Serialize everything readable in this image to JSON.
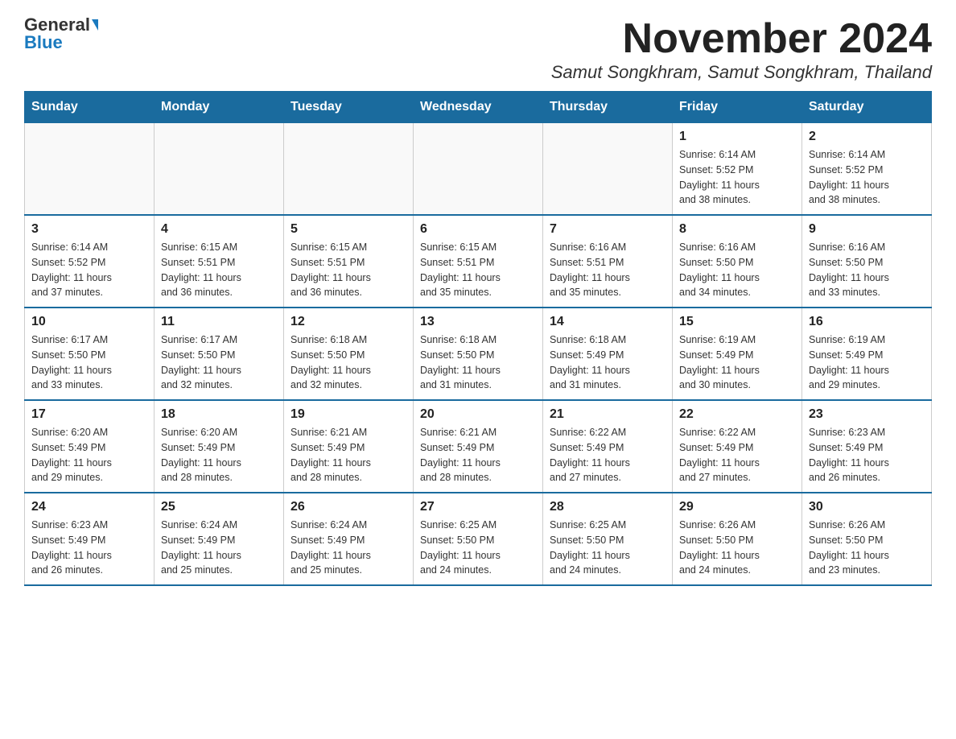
{
  "logo": {
    "general": "General",
    "blue": "Blue"
  },
  "header": {
    "month": "November 2024",
    "location": "Samut Songkhram, Samut Songkhram, Thailand"
  },
  "weekdays": [
    "Sunday",
    "Monday",
    "Tuesday",
    "Wednesday",
    "Thursday",
    "Friday",
    "Saturday"
  ],
  "weeks": [
    [
      {
        "day": "",
        "info": ""
      },
      {
        "day": "",
        "info": ""
      },
      {
        "day": "",
        "info": ""
      },
      {
        "day": "",
        "info": ""
      },
      {
        "day": "",
        "info": ""
      },
      {
        "day": "1",
        "info": "Sunrise: 6:14 AM\nSunset: 5:52 PM\nDaylight: 11 hours\nand 38 minutes."
      },
      {
        "day": "2",
        "info": "Sunrise: 6:14 AM\nSunset: 5:52 PM\nDaylight: 11 hours\nand 38 minutes."
      }
    ],
    [
      {
        "day": "3",
        "info": "Sunrise: 6:14 AM\nSunset: 5:52 PM\nDaylight: 11 hours\nand 37 minutes."
      },
      {
        "day": "4",
        "info": "Sunrise: 6:15 AM\nSunset: 5:51 PM\nDaylight: 11 hours\nand 36 minutes."
      },
      {
        "day": "5",
        "info": "Sunrise: 6:15 AM\nSunset: 5:51 PM\nDaylight: 11 hours\nand 36 minutes."
      },
      {
        "day": "6",
        "info": "Sunrise: 6:15 AM\nSunset: 5:51 PM\nDaylight: 11 hours\nand 35 minutes."
      },
      {
        "day": "7",
        "info": "Sunrise: 6:16 AM\nSunset: 5:51 PM\nDaylight: 11 hours\nand 35 minutes."
      },
      {
        "day": "8",
        "info": "Sunrise: 6:16 AM\nSunset: 5:50 PM\nDaylight: 11 hours\nand 34 minutes."
      },
      {
        "day": "9",
        "info": "Sunrise: 6:16 AM\nSunset: 5:50 PM\nDaylight: 11 hours\nand 33 minutes."
      }
    ],
    [
      {
        "day": "10",
        "info": "Sunrise: 6:17 AM\nSunset: 5:50 PM\nDaylight: 11 hours\nand 33 minutes."
      },
      {
        "day": "11",
        "info": "Sunrise: 6:17 AM\nSunset: 5:50 PM\nDaylight: 11 hours\nand 32 minutes."
      },
      {
        "day": "12",
        "info": "Sunrise: 6:18 AM\nSunset: 5:50 PM\nDaylight: 11 hours\nand 32 minutes."
      },
      {
        "day": "13",
        "info": "Sunrise: 6:18 AM\nSunset: 5:50 PM\nDaylight: 11 hours\nand 31 minutes."
      },
      {
        "day": "14",
        "info": "Sunrise: 6:18 AM\nSunset: 5:49 PM\nDaylight: 11 hours\nand 31 minutes."
      },
      {
        "day": "15",
        "info": "Sunrise: 6:19 AM\nSunset: 5:49 PM\nDaylight: 11 hours\nand 30 minutes."
      },
      {
        "day": "16",
        "info": "Sunrise: 6:19 AM\nSunset: 5:49 PM\nDaylight: 11 hours\nand 29 minutes."
      }
    ],
    [
      {
        "day": "17",
        "info": "Sunrise: 6:20 AM\nSunset: 5:49 PM\nDaylight: 11 hours\nand 29 minutes."
      },
      {
        "day": "18",
        "info": "Sunrise: 6:20 AM\nSunset: 5:49 PM\nDaylight: 11 hours\nand 28 minutes."
      },
      {
        "day": "19",
        "info": "Sunrise: 6:21 AM\nSunset: 5:49 PM\nDaylight: 11 hours\nand 28 minutes."
      },
      {
        "day": "20",
        "info": "Sunrise: 6:21 AM\nSunset: 5:49 PM\nDaylight: 11 hours\nand 28 minutes."
      },
      {
        "day": "21",
        "info": "Sunrise: 6:22 AM\nSunset: 5:49 PM\nDaylight: 11 hours\nand 27 minutes."
      },
      {
        "day": "22",
        "info": "Sunrise: 6:22 AM\nSunset: 5:49 PM\nDaylight: 11 hours\nand 27 minutes."
      },
      {
        "day": "23",
        "info": "Sunrise: 6:23 AM\nSunset: 5:49 PM\nDaylight: 11 hours\nand 26 minutes."
      }
    ],
    [
      {
        "day": "24",
        "info": "Sunrise: 6:23 AM\nSunset: 5:49 PM\nDaylight: 11 hours\nand 26 minutes."
      },
      {
        "day": "25",
        "info": "Sunrise: 6:24 AM\nSunset: 5:49 PM\nDaylight: 11 hours\nand 25 minutes."
      },
      {
        "day": "26",
        "info": "Sunrise: 6:24 AM\nSunset: 5:49 PM\nDaylight: 11 hours\nand 25 minutes."
      },
      {
        "day": "27",
        "info": "Sunrise: 6:25 AM\nSunset: 5:50 PM\nDaylight: 11 hours\nand 24 minutes."
      },
      {
        "day": "28",
        "info": "Sunrise: 6:25 AM\nSunset: 5:50 PM\nDaylight: 11 hours\nand 24 minutes."
      },
      {
        "day": "29",
        "info": "Sunrise: 6:26 AM\nSunset: 5:50 PM\nDaylight: 11 hours\nand 24 minutes."
      },
      {
        "day": "30",
        "info": "Sunrise: 6:26 AM\nSunset: 5:50 PM\nDaylight: 11 hours\nand 23 minutes."
      }
    ]
  ]
}
